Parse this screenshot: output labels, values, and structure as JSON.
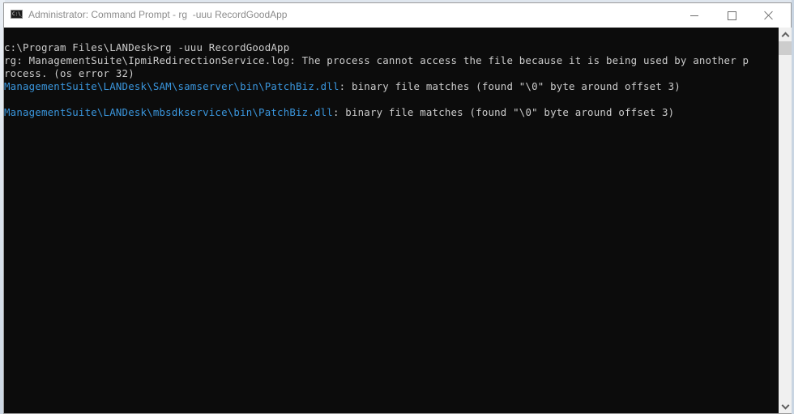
{
  "window": {
    "title": "Administrator: Command Prompt - rg  -uuu RecordGoodApp",
    "app_icon_label": "C:\\_",
    "controls": {
      "minimize": "minimize-icon",
      "maximize": "maximize-icon",
      "close": "close-icon"
    }
  },
  "console": {
    "background": "#0c0c0c",
    "text_color": "#cccccc",
    "path_color": "#3a96dd",
    "lines": [
      {
        "prompt": "c:\\Program Files\\LANDesk>",
        "command": "rg -uuu RecordGoodApp"
      },
      {
        "text": "rg: ManagementSuite\\IpmiRedirectionService.log: The process cannot access the file because it is being used by another p"
      },
      {
        "text": "rocess. (os error 32)"
      },
      {
        "path": "ManagementSuite\\LANDesk\\SAM\\samserver\\bin\\PatchBiz.dll",
        "message": ": binary file matches (found \"\\0\" byte around offset 3)"
      },
      {
        "text": ""
      },
      {
        "path": "ManagementSuite\\LANDesk\\mbsdkservice\\bin\\PatchBiz.dll",
        "message": ": binary file matches (found \"\\0\" byte around offset 3)"
      }
    ]
  },
  "scrollbar": {
    "up_icon": "chevron-up-icon",
    "down_icon": "chevron-down-icon"
  }
}
